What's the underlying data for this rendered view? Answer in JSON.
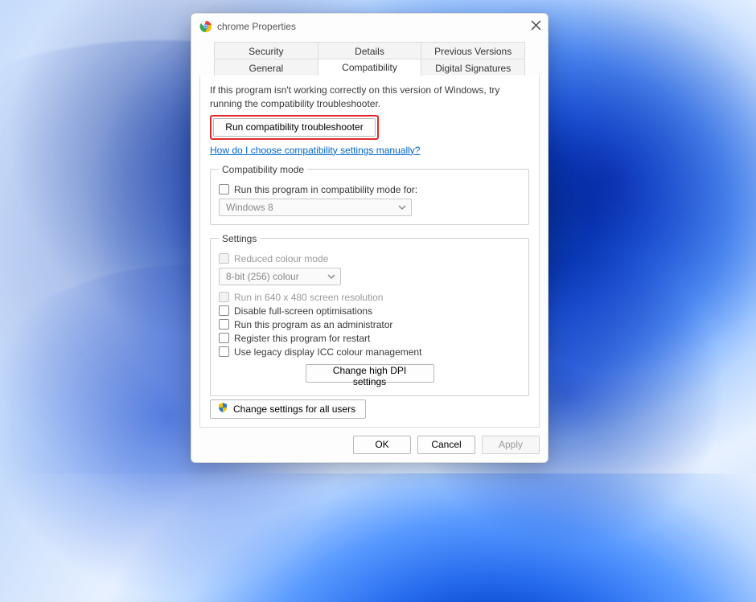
{
  "window": {
    "title": "chrome Properties"
  },
  "tabs": {
    "row1": [
      "Security",
      "Details",
      "Previous Versions"
    ],
    "row2": [
      "General",
      "Compatibility",
      "Digital Signatures"
    ],
    "active": "Compatibility"
  },
  "intro": "If this program isn't working correctly on this version of Windows, try running the compatibility troubleshooter.",
  "run_troubleshooter": "Run compatibility troubleshooter",
  "help_link": "How do I choose compatibility settings manually?",
  "compat_mode": {
    "legend": "Compatibility mode",
    "checkbox": "Run this program in compatibility mode for:",
    "selected": "Windows 8"
  },
  "settings": {
    "legend": "Settings",
    "reduced_colour": "Reduced colour mode",
    "colour_selected": "8-bit (256) colour",
    "run_640": "Run in 640 x 480 screen resolution",
    "disable_fullscreen": "Disable full-screen optimisations",
    "run_admin": "Run this program as an administrator",
    "register_restart": "Register this program for restart",
    "legacy_icc": "Use legacy display ICC colour management",
    "high_dpi_btn": "Change high DPI settings"
  },
  "all_users_btn": "Change settings for all users",
  "footer": {
    "ok": "OK",
    "cancel": "Cancel",
    "apply": "Apply"
  }
}
